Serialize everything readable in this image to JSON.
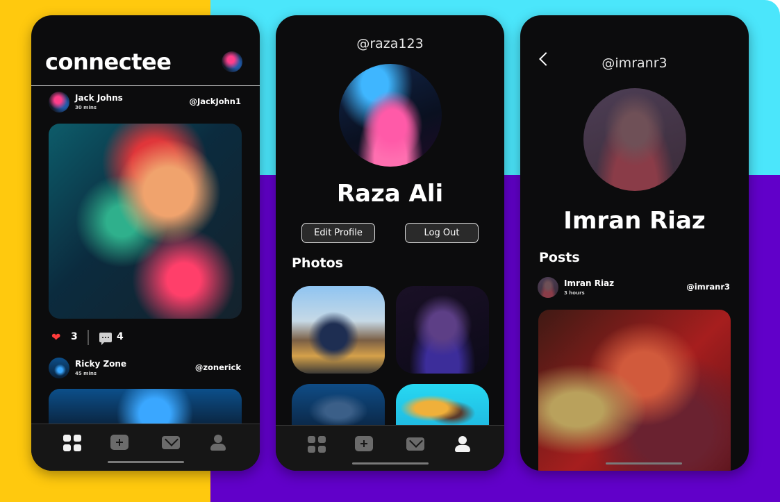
{
  "feed_screen": {
    "app_title": "connectee",
    "posts": [
      {
        "name": "Jack Johns",
        "time": "30 mins",
        "handle": "@JackJohn1",
        "likes": "3",
        "comments": "4"
      },
      {
        "name": "Ricky Zone",
        "time": "45 mins",
        "handle": "@zonerick"
      }
    ],
    "nav_active": "home"
  },
  "profile_screen": {
    "handle": "@raza123",
    "name": "Raza Ali",
    "edit_label": "Edit Profile",
    "logout_label": "Log Out",
    "photos_title": "Photos",
    "nav_active": "profile"
  },
  "user_screen": {
    "handle": "@imranr3",
    "name": "Imran Riaz",
    "posts_title": "Posts",
    "post": {
      "name": "Imran Riaz",
      "time": "3 hours",
      "handle": "@imranr3"
    }
  },
  "colors": {
    "yellow": "#ffc90e",
    "cyan": "#4be6fb",
    "purple": "#6100c9",
    "phone_bg": "#0c0c0d",
    "like": "#ff3b3b"
  },
  "icons": [
    "home-grid-icon",
    "add-post-icon",
    "messages-icon",
    "profile-icon",
    "heart-icon",
    "comment-icon",
    "back-chevron-icon"
  ]
}
